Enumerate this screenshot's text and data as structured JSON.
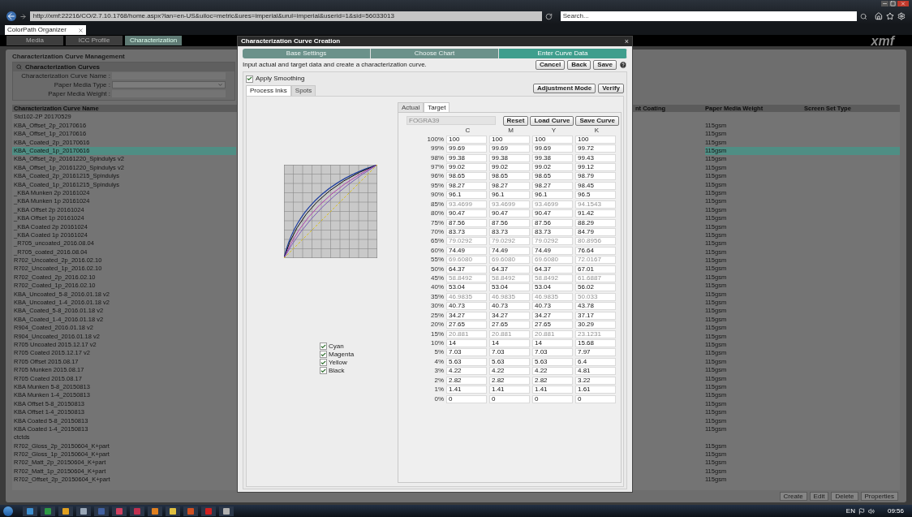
{
  "browser": {
    "address": "http://xmf:22216/CO/2.7.10.1768/home.aspx?lan=en-US&uiloc=metric&ures=imperial&urul=imperial&userid=1&sid=56033013",
    "search_placeholder": "Search...",
    "tab": "ColorPath Organizer"
  },
  "nav_tabs": [
    {
      "label": "Media",
      "selected": false
    },
    {
      "label": "ICC Profile",
      "selected": false
    },
    {
      "label": "Characterization",
      "selected": true
    }
  ],
  "logo": "xmf",
  "panel": {
    "title": "Characterization Curve Management",
    "filter_title": "Characterization Curves",
    "fields": [
      {
        "label": "Characterization Curve Name :",
        "kind": "text"
      },
      {
        "label": "Paper Media Type :",
        "kind": "select"
      },
      {
        "label": "Paper Media Weight :",
        "kind": "text"
      }
    ],
    "columns": [
      "Characterization Curve Name",
      "nt Coating",
      "Paper Media Weight",
      "Screen Set Type"
    ],
    "rows": [
      {
        "name": "Std102-2P 20170529",
        "selected": false
      },
      {
        "name": "KBA_Offset_2p_20170616",
        "weight": "115gsm",
        "selected": false
      },
      {
        "name": "KBA_Offset_1p_20170616",
        "weight": "115gsm",
        "selected": false
      },
      {
        "name": "KBA_Coated_2p_20170616",
        "weight": "115gsm",
        "selected": false
      },
      {
        "name": "KBA_Coated_1p_20170616",
        "weight": "115gsm",
        "selected": true
      },
      {
        "name": "KBA_Offset_2p_20161220_Spindulys v2",
        "weight": "115gsm",
        "selected": false
      },
      {
        "name": "KBA_Offset_1p_20161220_Spindulys v2",
        "weight": "115gsm",
        "selected": false
      },
      {
        "name": "KBA_Coated_2p_20161215_Spindulys",
        "weight": "115gsm",
        "selected": false
      },
      {
        "name": "KBA_Coated_1p_20161215_Spindulys",
        "weight": "115gsm",
        "selected": false
      },
      {
        "name": "_KBA Munken 2p 20161024",
        "weight": "115gsm",
        "selected": false
      },
      {
        "name": "_KBA Munken 1p 20161024",
        "weight": "115gsm",
        "selected": false
      },
      {
        "name": "_KBA Offset 2p 20161024",
        "weight": "115gsm",
        "selected": false
      },
      {
        "name": "_KBA Offset 1p 20161024",
        "weight": "115gsm",
        "selected": false
      },
      {
        "name": "_KBA Coated 2p 20161024",
        "weight": "115gsm",
        "selected": false
      },
      {
        "name": "_KBA Coated 1p 20161024",
        "weight": "115gsm",
        "selected": false
      },
      {
        "name": "_R705_uncoated_2016.08.04",
        "weight": "115gsm",
        "selected": false
      },
      {
        "name": "_R705_coated_2016.08.04",
        "weight": "115gsm",
        "selected": false
      },
      {
        "name": "R702_Uncoated_2p_2016.02.10",
        "weight": "115gsm",
        "selected": false
      },
      {
        "name": "R702_Uncoated_1p_2016.02.10",
        "weight": "115gsm",
        "selected": false
      },
      {
        "name": "R702_Coated_2p_2016.02.10",
        "weight": "115gsm",
        "selected": false
      },
      {
        "name": "R702_Coated_1p_2016.02.10",
        "weight": "115gsm",
        "selected": false
      },
      {
        "name": "KBA_Uncoated_5-8_2016.01.18 v2",
        "weight": "115gsm",
        "selected": false
      },
      {
        "name": "KBA_Uncoated_1-4_2016.01.18 v2",
        "weight": "115gsm",
        "selected": false
      },
      {
        "name": "KBA_Coated_5-8_2016.01.18 v2",
        "weight": "115gsm",
        "selected": false
      },
      {
        "name": "KBA_Coated_1-4_2016.01.18 v2",
        "weight": "115gsm",
        "selected": false
      },
      {
        "name": "R904_Coated_2016.01.18 v2",
        "weight": "115gsm",
        "selected": false
      },
      {
        "name": "R904_Uncoated_2016.01.18 v2",
        "weight": "115gsm",
        "selected": false
      },
      {
        "name": "R705 Uncoated 2015.12.17 v2",
        "weight": "115gsm",
        "selected": false
      },
      {
        "name": "R705 Coated 2015.12.17 v2",
        "weight": "115gsm",
        "selected": false
      },
      {
        "name": "R705 Offset 2015.08.17",
        "weight": "115gsm",
        "selected": false
      },
      {
        "name": "R705 Munken 2015.08.17",
        "weight": "115gsm",
        "selected": false
      },
      {
        "name": "R705 Coated 2015.08.17",
        "weight": "115gsm",
        "selected": false
      },
      {
        "name": "KBA Munken 5-8_20150813",
        "weight": "115gsm",
        "selected": false
      },
      {
        "name": "KBA Munken 1-4_20150813",
        "weight": "115gsm",
        "selected": false
      },
      {
        "name": "KBA Offset 5-8_20150813",
        "weight": "115gsm",
        "selected": false
      },
      {
        "name": "KBA Offset 1-4_20150813",
        "weight": "115gsm",
        "selected": false
      },
      {
        "name": "KBA Coated 5-8_20150813",
        "weight": "115gsm",
        "selected": false
      },
      {
        "name": "KBA Coated 1-4_20150813",
        "weight": "115gsm",
        "selected": false
      },
      {
        "name": "ctctds",
        "selected": false
      },
      {
        "name": "R702_Gloss_2p_20150604_K+part",
        "weight": "115gsm",
        "selected": false
      },
      {
        "name": "R702_Gloss_1p_20150604_K+part",
        "weight": "115gsm",
        "selected": false
      },
      {
        "name": "R702_Matt_2p_20150604_K+part",
        "weight": "115gsm",
        "selected": false
      },
      {
        "name": "R702_Matt_1p_20150604_K+part",
        "weight": "115gsm",
        "selected": false
      },
      {
        "name": "R702_Offset_2p_20150604_K+part",
        "weight": "115gsm",
        "selected": false
      }
    ],
    "buttons": [
      "Create",
      "Edit",
      "Delete",
      "Properties"
    ]
  },
  "dialog": {
    "title": "Characterization Curve Creation",
    "close": "×",
    "steps": [
      {
        "label": "Base Settings",
        "selected": false
      },
      {
        "label": "Choose Chart",
        "selected": false
      },
      {
        "label": "Enter Curve Data",
        "selected": true
      }
    ],
    "instruction": "Input actual and target data and create a characterization curve.",
    "buttons": [
      "Cancel",
      "Back",
      "Save"
    ],
    "smoothing": {
      "label": "Apply Smoothing",
      "checked": true
    },
    "tabs": [
      {
        "label": "Process Inks",
        "selected": true
      },
      {
        "label": "Spots",
        "selected": false
      }
    ],
    "mode_buttons": [
      "Adjustment Mode",
      "Verify"
    ],
    "legend": [
      {
        "label": "Cyan",
        "checked": true
      },
      {
        "label": "Magenta",
        "checked": true
      },
      {
        "label": "Yellow",
        "checked": true
      },
      {
        "label": "Black",
        "checked": true
      }
    ],
    "data_tabs": [
      {
        "label": "Actual",
        "selected": false
      },
      {
        "label": "Target",
        "selected": true
      }
    ],
    "reference": "FOGRA39",
    "curve_buttons": [
      "Reset",
      "Load Curve",
      "Save Curve"
    ],
    "columns": [
      "C",
      "M",
      "Y",
      "K"
    ],
    "rows": [
      {
        "label": "100%",
        "values": [
          "100",
          "100",
          "100",
          "100"
        ],
        "interpolated": false
      },
      {
        "label": "99%",
        "values": [
          "99.69",
          "99.69",
          "99.69",
          "99.72"
        ],
        "interpolated": false
      },
      {
        "label": "98%",
        "values": [
          "99.38",
          "99.38",
          "99.38",
          "99.43"
        ],
        "interpolated": false
      },
      {
        "label": "97%",
        "values": [
          "99.02",
          "99.02",
          "99.02",
          "99.12"
        ],
        "interpolated": false
      },
      {
        "label": "96%",
        "values": [
          "98.65",
          "98.65",
          "98.65",
          "98.79"
        ],
        "interpolated": false
      },
      {
        "label": "95%",
        "values": [
          "98.27",
          "98.27",
          "98.27",
          "98.45"
        ],
        "interpolated": false
      },
      {
        "label": "90%",
        "values": [
          "96.1",
          "96.1",
          "96.1",
          "96.5"
        ],
        "interpolated": false
      },
      {
        "label": "85%",
        "values": [
          "93.4699",
          "93.4699",
          "93.4699",
          "94.1543"
        ],
        "interpolated": true
      },
      {
        "label": "80%",
        "values": [
          "90.47",
          "90.47",
          "90.47",
          "91.42"
        ],
        "interpolated": false
      },
      {
        "label": "75%",
        "values": [
          "87.56",
          "87.56",
          "87.56",
          "88.29"
        ],
        "interpolated": false
      },
      {
        "label": "70%",
        "values": [
          "83.73",
          "83.73",
          "83.73",
          "84.79"
        ],
        "interpolated": false
      },
      {
        "label": "65%",
        "values": [
          "79.0292",
          "79.0292",
          "79.0292",
          "80.8956"
        ],
        "interpolated": true
      },
      {
        "label": "60%",
        "values": [
          "74.49",
          "74.49",
          "74.49",
          "76.64"
        ],
        "interpolated": false
      },
      {
        "label": "55%",
        "values": [
          "69.6080",
          "69.6080",
          "69.6080",
          "72.0167"
        ],
        "interpolated": true
      },
      {
        "label": "50%",
        "values": [
          "64.37",
          "64.37",
          "64.37",
          "67.01"
        ],
        "interpolated": false
      },
      {
        "label": "45%",
        "values": [
          "58.8492",
          "58.8492",
          "58.8492",
          "61.6887"
        ],
        "interpolated": true
      },
      {
        "label": "40%",
        "values": [
          "53.04",
          "53.04",
          "53.04",
          "56.02"
        ],
        "interpolated": false
      },
      {
        "label": "35%",
        "values": [
          "46.9835",
          "46.9835",
          "46.9835",
          "50.033"
        ],
        "interpolated": true
      },
      {
        "label": "30%",
        "values": [
          "40.73",
          "40.73",
          "40.73",
          "43.78"
        ],
        "interpolated": false
      },
      {
        "label": "25%",
        "values": [
          "34.27",
          "34.27",
          "34.27",
          "37.17"
        ],
        "interpolated": false
      },
      {
        "label": "20%",
        "values": [
          "27.65",
          "27.65",
          "27.65",
          "30.29"
        ],
        "interpolated": false
      },
      {
        "label": "15%",
        "values": [
          "20.881",
          "20.881",
          "20.881",
          "23.1231"
        ],
        "interpolated": true
      },
      {
        "label": "10%",
        "values": [
          "14",
          "14",
          "14",
          "15.68"
        ],
        "interpolated": false
      },
      {
        "label": "5%",
        "values": [
          "7.03",
          "7.03",
          "7.03",
          "7.97"
        ],
        "interpolated": false
      },
      {
        "label": "4%",
        "values": [
          "5.63",
          "5.63",
          "5.63",
          "6.4"
        ],
        "interpolated": false
      },
      {
        "label": "3%",
        "values": [
          "4.22",
          "4.22",
          "4.22",
          "4.81"
        ],
        "interpolated": false
      },
      {
        "label": "2%",
        "values": [
          "2.82",
          "2.82",
          "2.82",
          "3.22"
        ],
        "interpolated": false
      },
      {
        "label": "1%",
        "values": [
          "1.41",
          "1.41",
          "1.41",
          "1.61"
        ],
        "interpolated": false
      },
      {
        "label": "0%",
        "values": [
          "0",
          "0",
          "0",
          "0"
        ],
        "interpolated": false
      }
    ]
  },
  "taskbar": {
    "language": "EN",
    "clock": "09:56"
  }
}
